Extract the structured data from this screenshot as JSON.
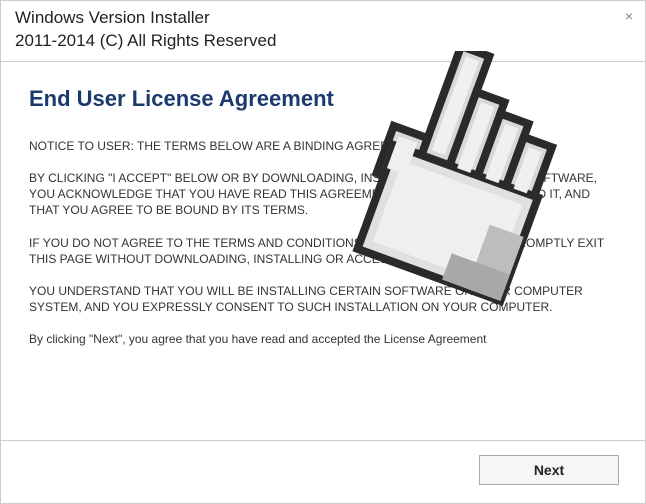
{
  "titlebar": {
    "title": "Windows Version Installer",
    "subtitle": "2011-2014 (C) All Rights Reserved",
    "close": "×"
  },
  "content": {
    "heading": "End User License Agreement",
    "p1": "NOTICE TO USER: THE TERMS BELOW ARE A BINDING AGREEMENT.",
    "p2": "BY CLICKING \"I ACCEPT\" BELOW OR BY DOWNLOADING, INSTALLING OR USING THIS SOFTWARE, YOU ACKNOWLEDGE THAT YOU HAVE READ THIS AGREEMENT, THAT YOU UNDERSTAND IT, AND THAT YOU AGREE TO BE BOUND BY ITS TERMS.",
    "p3": "IF YOU DO NOT AGREE TO THE TERMS AND CONDITIONS OF THIS LICENSE, THEN PROMPTLY EXIT THIS PAGE WITHOUT DOWNLOADING, INSTALLING OR ACCESSING THE SOFTWARE.",
    "p4": "YOU UNDERSTAND THAT YOU WILL BE INSTALLING CERTAIN SOFTWARE ON YOUR COMPUTER SYSTEM, AND YOU EXPRESSLY CONSENT TO SUCH INSTALLATION ON YOUR COMPUTER.",
    "p5": "By clicking \"Next\", you agree that you have read and accepted the License Agreement"
  },
  "footer": {
    "next_label": "Next"
  },
  "overlay": {
    "icon_name": "hand-cursor-icon"
  }
}
